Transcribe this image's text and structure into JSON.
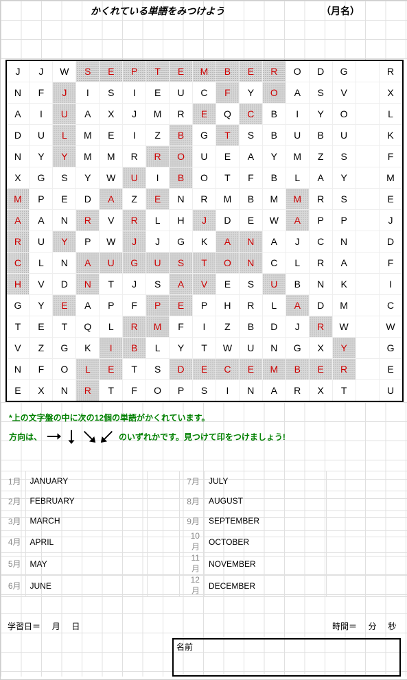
{
  "title": "かくれている単語をみつけよう",
  "category": "（月名）",
  "grid": [
    [
      [
        "J",
        0
      ],
      [
        "J",
        0
      ],
      [
        "W",
        0
      ],
      [
        "S",
        1
      ],
      [
        "E",
        1
      ],
      [
        "P",
        1
      ],
      [
        "T",
        1
      ],
      [
        "E",
        1
      ],
      [
        "M",
        1
      ],
      [
        "B",
        1
      ],
      [
        "E",
        1
      ],
      [
        "R",
        1
      ],
      [
        "O",
        0
      ],
      [
        "D",
        0
      ],
      [
        "G",
        0
      ],
      [
        " ",
        0
      ],
      [
        "R",
        0
      ]
    ],
    [
      [
        "N",
        0
      ],
      [
        "F",
        0
      ],
      [
        "J",
        1
      ],
      [
        "I",
        0
      ],
      [
        "S",
        0
      ],
      [
        "I",
        0
      ],
      [
        "E",
        0
      ],
      [
        "U",
        0
      ],
      [
        "C",
        0
      ],
      [
        "F",
        1
      ],
      [
        "Y",
        0
      ],
      [
        "O",
        1
      ],
      [
        "A",
        0
      ],
      [
        "S",
        0
      ],
      [
        "V",
        0
      ],
      [
        " ",
        0
      ],
      [
        "X",
        0
      ]
    ],
    [
      [
        "A",
        0
      ],
      [
        "I",
        0
      ],
      [
        "U",
        1
      ],
      [
        "A",
        0
      ],
      [
        "X",
        0
      ],
      [
        "J",
        0
      ],
      [
        "M",
        0
      ],
      [
        "R",
        0
      ],
      [
        "E",
        1
      ],
      [
        "Q",
        0
      ],
      [
        "C",
        1
      ],
      [
        "B",
        0
      ],
      [
        "I",
        0
      ],
      [
        "Y",
        0
      ],
      [
        "O",
        0
      ],
      [
        " ",
        0
      ],
      [
        "L",
        0
      ]
    ],
    [
      [
        "D",
        0
      ],
      [
        "U",
        0
      ],
      [
        "L",
        1
      ],
      [
        "M",
        0
      ],
      [
        "E",
        0
      ],
      [
        "I",
        0
      ],
      [
        "Z",
        0
      ],
      [
        "B",
        1
      ],
      [
        "G",
        0
      ],
      [
        "T",
        1
      ],
      [
        "S",
        0
      ],
      [
        "B",
        0
      ],
      [
        "U",
        0
      ],
      [
        "B",
        0
      ],
      [
        "U",
        0
      ],
      [
        " ",
        0
      ],
      [
        "K",
        0
      ]
    ],
    [
      [
        "N",
        0
      ],
      [
        "Y",
        0
      ],
      [
        "Y",
        1
      ],
      [
        "M",
        0
      ],
      [
        "M",
        0
      ],
      [
        "R",
        0
      ],
      [
        "R",
        1
      ],
      [
        "O",
        1
      ],
      [
        "U",
        0
      ],
      [
        "E",
        0
      ],
      [
        "A",
        0
      ],
      [
        "Y",
        0
      ],
      [
        "M",
        0
      ],
      [
        "Z",
        0
      ],
      [
        "S",
        0
      ],
      [
        " ",
        0
      ],
      [
        "F",
        0
      ]
    ],
    [
      [
        "X",
        0
      ],
      [
        "G",
        0
      ],
      [
        "S",
        0
      ],
      [
        "Y",
        0
      ],
      [
        "W",
        0
      ],
      [
        "U",
        1
      ],
      [
        "I",
        0
      ],
      [
        "B",
        1
      ],
      [
        "O",
        0
      ],
      [
        "T",
        0
      ],
      [
        "F",
        0
      ],
      [
        "B",
        0
      ],
      [
        "L",
        0
      ],
      [
        "A",
        0
      ],
      [
        "Y",
        0
      ],
      [
        " ",
        0
      ],
      [
        "M",
        0
      ]
    ],
    [
      [
        "M",
        1
      ],
      [
        "P",
        0
      ],
      [
        "E",
        0
      ],
      [
        "D",
        0
      ],
      [
        "A",
        1
      ],
      [
        "Z",
        0
      ],
      [
        "E",
        1
      ],
      [
        "N",
        0
      ],
      [
        "R",
        0
      ],
      [
        "M",
        0
      ],
      [
        "B",
        0
      ],
      [
        "M",
        0
      ],
      [
        "M",
        1
      ],
      [
        "R",
        0
      ],
      [
        "S",
        0
      ],
      [
        " ",
        0
      ],
      [
        "E",
        0
      ]
    ],
    [
      [
        "A",
        1
      ],
      [
        "A",
        0
      ],
      [
        "N",
        0
      ],
      [
        "R",
        1
      ],
      [
        "V",
        0
      ],
      [
        "R",
        1
      ],
      [
        "L",
        0
      ],
      [
        "H",
        0
      ],
      [
        "J",
        1
      ],
      [
        "D",
        0
      ],
      [
        "E",
        0
      ],
      [
        "W",
        0
      ],
      [
        "A",
        1
      ],
      [
        "P",
        0
      ],
      [
        "P",
        0
      ],
      [
        " ",
        0
      ],
      [
        "J",
        0
      ]
    ],
    [
      [
        "R",
        1
      ],
      [
        "U",
        0
      ],
      [
        "Y",
        1
      ],
      [
        "P",
        0
      ],
      [
        "W",
        0
      ],
      [
        "J",
        1
      ],
      [
        "J",
        0
      ],
      [
        "G",
        0
      ],
      [
        "K",
        0
      ],
      [
        "A",
        1
      ],
      [
        "N",
        1
      ],
      [
        "A",
        0
      ],
      [
        "J",
        0
      ],
      [
        "C",
        0
      ],
      [
        "N",
        0
      ],
      [
        " ",
        0
      ],
      [
        "D",
        0
      ]
    ],
    [
      [
        "C",
        1
      ],
      [
        "L",
        0
      ],
      [
        "N",
        0
      ],
      [
        "A",
        1
      ],
      [
        "U",
        1
      ],
      [
        "G",
        1
      ],
      [
        "U",
        1
      ],
      [
        "S",
        1
      ],
      [
        "T",
        1
      ],
      [
        "O",
        1
      ],
      [
        "N",
        1
      ],
      [
        "C",
        0
      ],
      [
        "L",
        0
      ],
      [
        "R",
        0
      ],
      [
        "A",
        0
      ],
      [
        " ",
        0
      ],
      [
        "F",
        0
      ]
    ],
    [
      [
        "H",
        1
      ],
      [
        "V",
        0
      ],
      [
        "D",
        0
      ],
      [
        "N",
        1
      ],
      [
        "T",
        0
      ],
      [
        "J",
        0
      ],
      [
        "S",
        0
      ],
      [
        "A",
        1
      ],
      [
        "V",
        1
      ],
      [
        "E",
        0
      ],
      [
        "S",
        0
      ],
      [
        "U",
        1
      ],
      [
        "B",
        0
      ],
      [
        "N",
        0
      ],
      [
        "K",
        0
      ],
      [
        " ",
        0
      ],
      [
        "I",
        0
      ]
    ],
    [
      [
        "G",
        0
      ],
      [
        "Y",
        0
      ],
      [
        "E",
        1
      ],
      [
        "A",
        0
      ],
      [
        "P",
        0
      ],
      [
        "F",
        0
      ],
      [
        "P",
        1
      ],
      [
        "E",
        1
      ],
      [
        "P",
        0
      ],
      [
        "H",
        0
      ],
      [
        "R",
        0
      ],
      [
        "L",
        0
      ],
      [
        "A",
        1
      ],
      [
        "D",
        0
      ],
      [
        "M",
        0
      ],
      [
        " ",
        0
      ],
      [
        "C",
        0
      ]
    ],
    [
      [
        "T",
        0
      ],
      [
        "E",
        0
      ],
      [
        "T",
        0
      ],
      [
        "Q",
        0
      ],
      [
        "L",
        0
      ],
      [
        "R",
        1
      ],
      [
        "M",
        1
      ],
      [
        "F",
        0
      ],
      [
        "I",
        0
      ],
      [
        "Z",
        0
      ],
      [
        "B",
        0
      ],
      [
        "D",
        0
      ],
      [
        "J",
        0
      ],
      [
        "R",
        1
      ],
      [
        "W",
        0
      ],
      [
        " ",
        0
      ],
      [
        "W",
        0
      ]
    ],
    [
      [
        "V",
        0
      ],
      [
        "Z",
        0
      ],
      [
        "G",
        0
      ],
      [
        "K",
        0
      ],
      [
        "I",
        1
      ],
      [
        "B",
        1
      ],
      [
        "L",
        0
      ],
      [
        "Y",
        0
      ],
      [
        "T",
        0
      ],
      [
        "W",
        0
      ],
      [
        "U",
        0
      ],
      [
        "N",
        0
      ],
      [
        "G",
        0
      ],
      [
        "X",
        0
      ],
      [
        "Y",
        1
      ],
      [
        " ",
        0
      ],
      [
        "G",
        0
      ]
    ],
    [
      [
        "N",
        0
      ],
      [
        "F",
        0
      ],
      [
        "O",
        0
      ],
      [
        "L",
        1
      ],
      [
        "E",
        1
      ],
      [
        "T",
        0
      ],
      [
        "S",
        0
      ],
      [
        "D",
        1
      ],
      [
        "E",
        1
      ],
      [
        "C",
        1
      ],
      [
        "E",
        1
      ],
      [
        "M",
        1
      ],
      [
        "B",
        1
      ],
      [
        "E",
        1
      ],
      [
        "R",
        1
      ],
      [
        " ",
        0
      ],
      [
        "E",
        0
      ]
    ],
    [
      [
        "E",
        0
      ],
      [
        "X",
        0
      ],
      [
        "N",
        0
      ],
      [
        "R",
        1
      ],
      [
        "T",
        0
      ],
      [
        "F",
        0
      ],
      [
        "O",
        0
      ],
      [
        "P",
        0
      ],
      [
        "S",
        0
      ],
      [
        "I",
        0
      ],
      [
        "N",
        0
      ],
      [
        "A",
        0
      ],
      [
        "R",
        0
      ],
      [
        "X",
        0
      ],
      [
        "T",
        0
      ],
      [
        " ",
        0
      ],
      [
        "U",
        0
      ]
    ]
  ],
  "note1": "*上の文字盤の中に次の12個の単語がかくれています。",
  "note2a": "方向は、",
  "note2b": "のいずれかです。見つけて印をつけましょう!",
  "months": [
    {
      "j": "1月",
      "e": "JANUARY",
      "j2": "7月",
      "e2": "JULY"
    },
    {
      "j": "2月",
      "e": "FEBRUARY",
      "j2": "8月",
      "e2": "AUGUST"
    },
    {
      "j": "3月",
      "e": "MARCH",
      "j2": "9月",
      "e2": "SEPTEMBER"
    },
    {
      "j": "4月",
      "e": "APRIL",
      "j2": "10月",
      "e2": "OCTOBER"
    },
    {
      "j": "5月",
      "e": "MAY",
      "j2": "11月",
      "e2": "NOVEMBER"
    },
    {
      "j": "6月",
      "e": "JUNE",
      "j2": "12月",
      "e2": "DECEMBER"
    }
  ],
  "study_label": "学習日＝",
  "study_m": "月",
  "study_d": "日",
  "time_label": "時間＝",
  "time_m": "分",
  "time_s": "秒",
  "name_label": "名前",
  "chart_data": {
    "type": "wordsearch",
    "rows": 16,
    "cols": 17,
    "words": [
      "JANUARY",
      "FEBRUARY",
      "MARCH",
      "APRIL",
      "MAY",
      "JUNE",
      "JULY",
      "AUGUST",
      "SEPTEMBER",
      "OCTOBER",
      "NOVEMBER",
      "DECEMBER"
    ],
    "directions": [
      "right",
      "down",
      "down-right",
      "down-left"
    ]
  }
}
